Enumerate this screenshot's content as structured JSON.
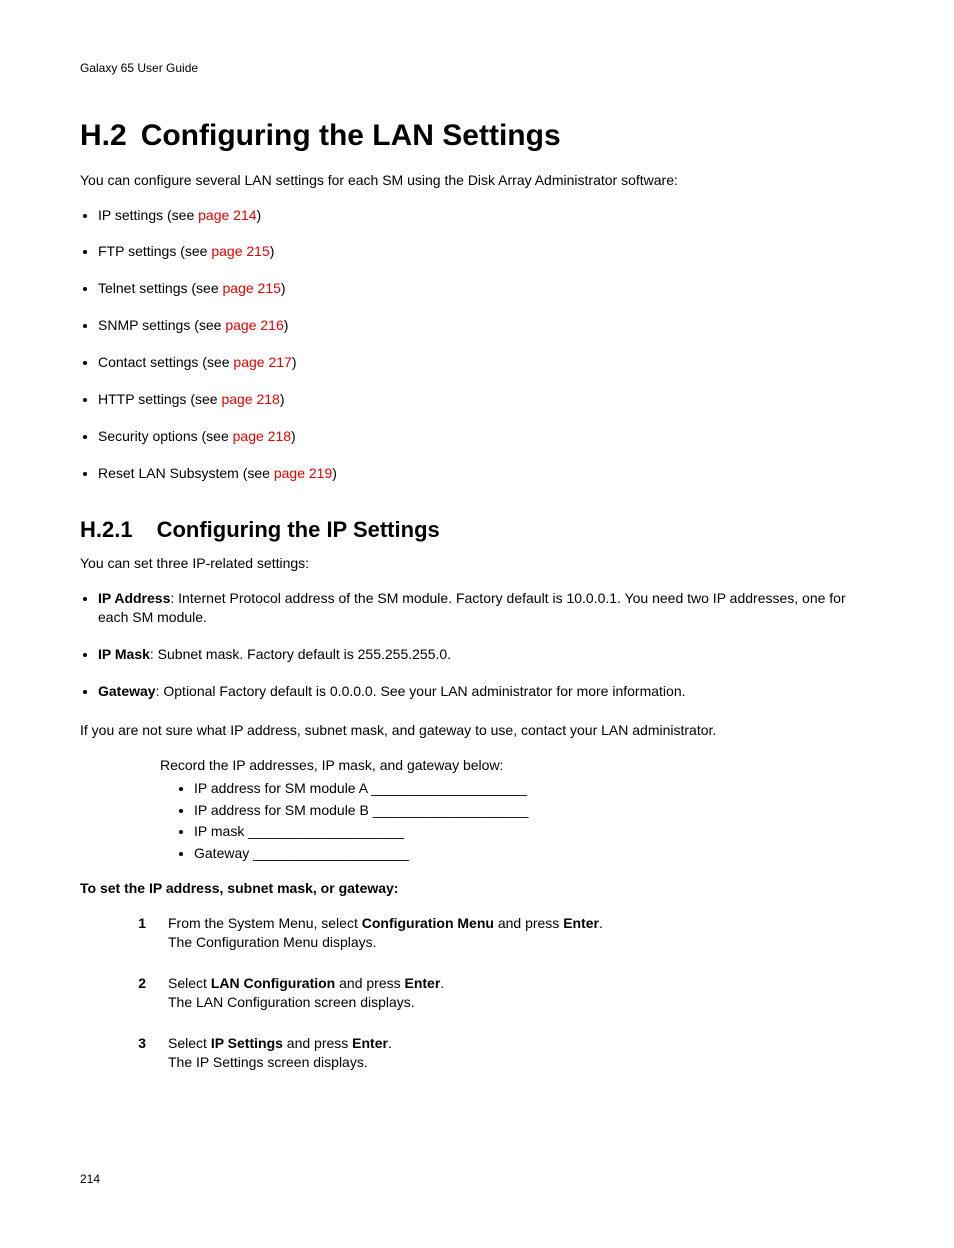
{
  "header": {
    "guide": "Galaxy 65 User Guide"
  },
  "h2": {
    "num": "H.2",
    "title": "Configuring the LAN Settings"
  },
  "intro": "You can configure several LAN settings for each SM using the Disk Array Administrator software:",
  "mainlist": [
    {
      "pre": "IP settings (see ",
      "link": "page 214",
      "post": ")"
    },
    {
      "pre": "FTP settings (see ",
      "link": "page 215",
      "post": ")"
    },
    {
      "pre": "Telnet settings (see ",
      "link": "page 215",
      "post": ")"
    },
    {
      "pre": "SNMP settings (see ",
      "link": "page 216",
      "post": ")"
    },
    {
      "pre": "Contact settings (see ",
      "link": "page 217",
      "post": ")"
    },
    {
      "pre": "HTTP settings (see ",
      "link": "page 218",
      "post": ")"
    },
    {
      "pre": "Security options (see ",
      "link": "page 218",
      "post": ")"
    },
    {
      "pre": "Reset LAN Subsystem (see ",
      "link": "page 219",
      "post": ")"
    }
  ],
  "h3": {
    "num": "H.2.1",
    "title": "Configuring the IP Settings"
  },
  "sub_intro": "You can set three IP-related settings:",
  "iplist": [
    {
      "b": "IP Address",
      "rest": ": Internet Protocol address of the SM module. Factory default is 10.0.0.1. You need two IP addresses, one for each SM module."
    },
    {
      "b": "IP Mask",
      "rest": ": Subnet mask. Factory default is 255.255.255.0."
    },
    {
      "b": "Gateway",
      "rest": ": Optional Factory default is 0.0.0.0. See your LAN administrator for more information."
    }
  ],
  "note1": "If you are not sure what IP address, subnet mask, and gateway to use, contact your LAN administrator.",
  "record_intro": "Record the IP addresses, IP mask, and gateway below:",
  "recordlist": [
    "IP address for SM module A ____________________",
    "IP address for SM module B ____________________",
    "IP mask ____________________",
    "Gateway ____________________"
  ],
  "proc_heading": "To set the IP address, subnet mask, or gateway:",
  "steps": [
    {
      "n": "1",
      "parts": [
        {
          "t": "From the System Menu, select "
        },
        {
          "b": "Configuration Menu"
        },
        {
          "t": " and press "
        },
        {
          "b": "Enter"
        },
        {
          "t": "."
        }
      ],
      "after": "The Configuration Menu displays."
    },
    {
      "n": "2",
      "parts": [
        {
          "t": "Select "
        },
        {
          "b": "LAN Configuration"
        },
        {
          "t": " and press "
        },
        {
          "b": "Enter"
        },
        {
          "t": "."
        }
      ],
      "after": "The LAN Configuration screen displays."
    },
    {
      "n": "3",
      "parts": [
        {
          "t": "Select "
        },
        {
          "b": "IP Settings"
        },
        {
          "t": " and press "
        },
        {
          "b": "Enter"
        },
        {
          "t": "."
        }
      ],
      "after": "The IP Settings screen displays."
    }
  ],
  "page_num": "214"
}
